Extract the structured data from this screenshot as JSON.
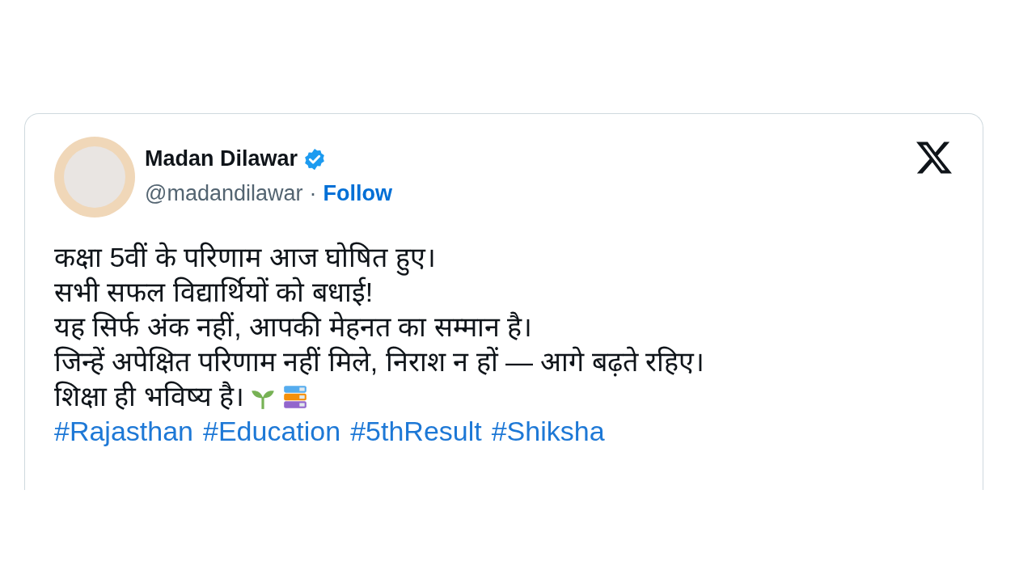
{
  "author": {
    "name": "Madan Dilawar",
    "verified": true,
    "handle": "@madandilawar",
    "separator": "·",
    "follow": "Follow"
  },
  "text_lines": [
    "कक्षा 5वीं के परिणाम आज घोषित हुए।",
    "सभी सफल विद्यार्थियों को बधाई!",
    "यह सिर्फ अंक नहीं, आपकी मेहनत का सम्मान है।",
    "जिन्हें अपेक्षित परिणाम नहीं मिले, निराश न हों — आगे बढ़ते रहिए।",
    "शिक्षा ही भविष्य है।"
  ],
  "hashtags": [
    "#Rajasthan",
    "#Education",
    "#5thResult",
    "#Shiksha"
  ]
}
